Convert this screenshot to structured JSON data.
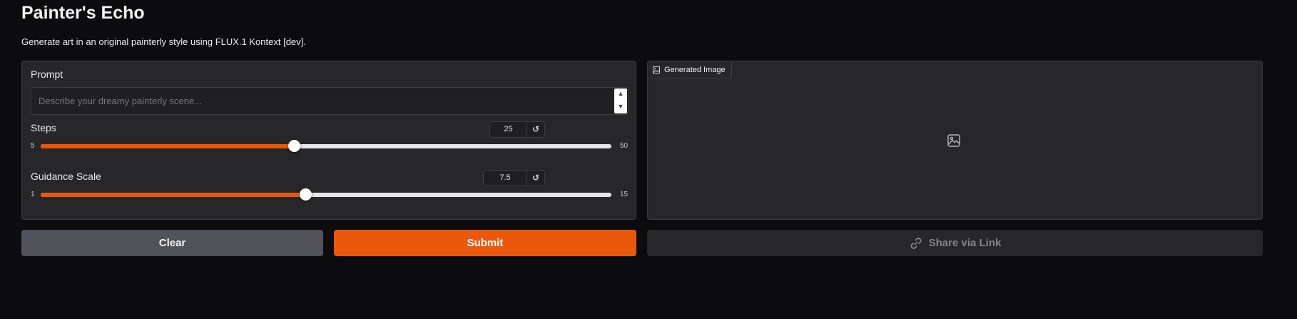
{
  "header": {
    "title": "Painter's Echo",
    "subtitle": "Generate art in an original painterly style using FLUX.1 Kontext [dev]."
  },
  "inputs": {
    "prompt": {
      "label": "Prompt",
      "value": "",
      "placeholder": "Describe your dreamy painterly scene..."
    },
    "steps": {
      "label": "Steps",
      "value": "25",
      "min": "5",
      "max": "50",
      "fraction": 0.444
    },
    "guidance": {
      "label": "Guidance Scale",
      "value": "7.5",
      "min": "1",
      "max": "15",
      "fraction": 0.464
    },
    "reset_icon": "reset-icon"
  },
  "output": {
    "label": "Generated Image",
    "label_icon": "image-icon",
    "placeholder_icon": "image-placeholder-icon"
  },
  "actions": {
    "clear_label": "Clear",
    "submit_label": "Submit",
    "share_label": "Share via Link",
    "share_icon": "link-icon"
  },
  "colors": {
    "accent": "#ea580c",
    "background": "#0c0c0f",
    "panel": "#27272a",
    "secondary_button": "#52525b"
  }
}
